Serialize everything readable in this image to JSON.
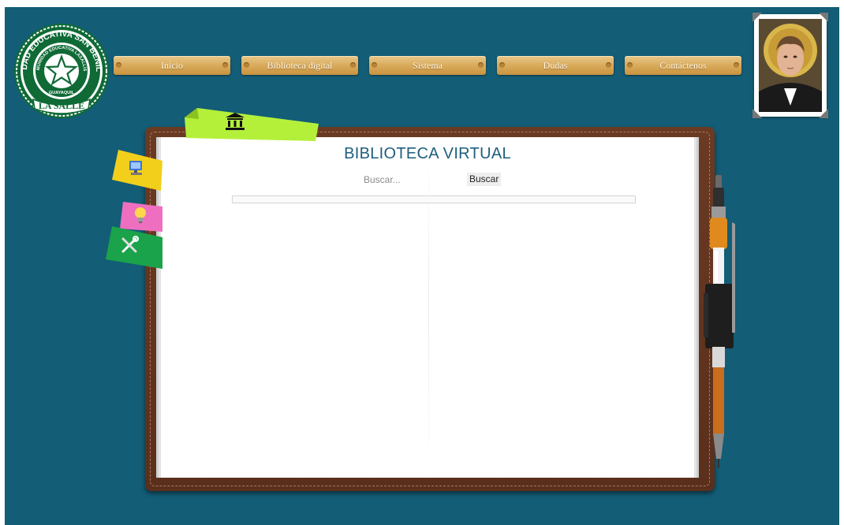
{
  "nav": {
    "items": [
      {
        "label": "Inicio"
      },
      {
        "label": "Biblioteca digital"
      },
      {
        "label": "Sistema"
      },
      {
        "label": "Dudas"
      },
      {
        "label": "Contáctenos"
      }
    ]
  },
  "logo": {
    "outer_text": "UNIDAD EDUCATIVA SAN BENILDO",
    "inner_text": "COMUNIDAD EDUCATIVA LASALLISTA",
    "city": "GUAYAQUIL",
    "ribbon": "LA SALLE"
  },
  "book": {
    "title": "BIBLIOTECA VIRTUAL",
    "search": {
      "placeholder": "Buscar...",
      "button_label": "Buscar"
    }
  },
  "tabs": {
    "top_icon": "library-icon",
    "side": [
      "computer-icon",
      "lightbulb-icon",
      "tools-icon"
    ]
  },
  "colors": {
    "background": "#135d76",
    "nav_button": "#d7a857",
    "book_cover": "#5a2f1c",
    "title": "#1d5e7c",
    "tab_top": "#b4f03a",
    "tab_blue": "#f2cf1a",
    "tab_pink": "#ee6fc0",
    "tab_green": "#1aa34a"
  }
}
